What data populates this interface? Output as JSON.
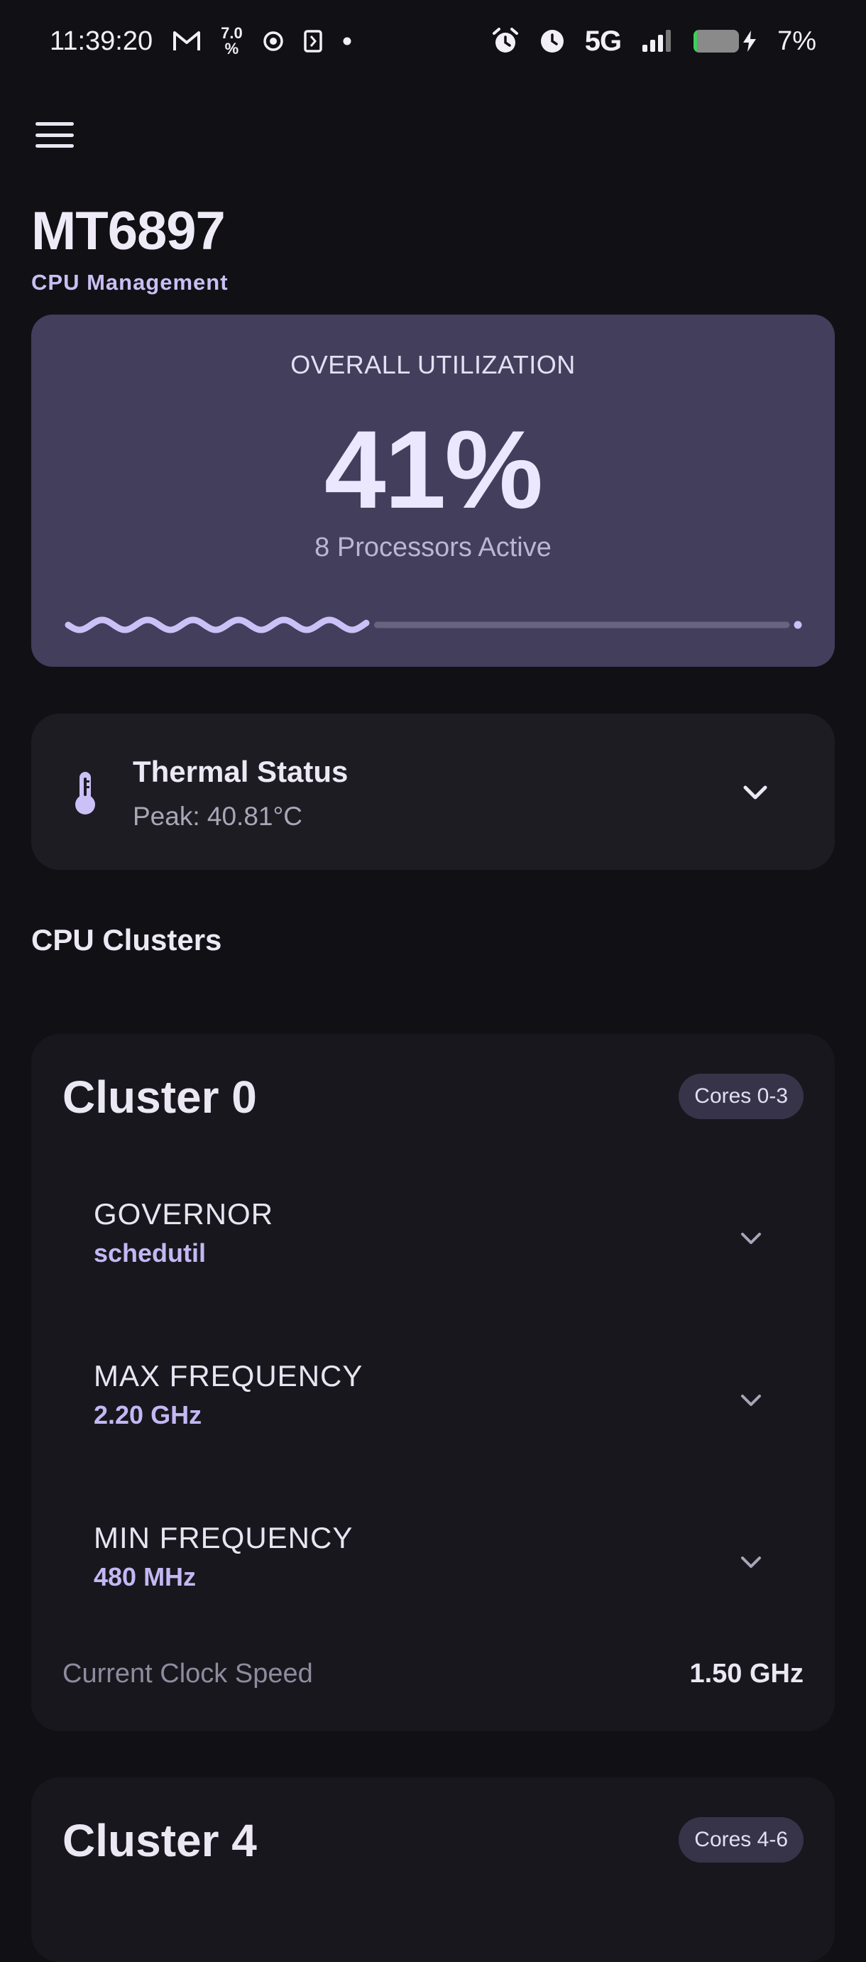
{
  "status_bar": {
    "time": "11:39:20",
    "indicator_top": "7.0",
    "indicator_bottom": "%",
    "network": "5G",
    "battery": "7%",
    "battery_level": 0.07,
    "icons": [
      "gmail-icon",
      "data-speed-icon",
      "record-icon",
      "sim-icon",
      "dot-icon",
      "alarm-icon",
      "clock-icon",
      "signal-icon",
      "battery-icon",
      "charging-icon"
    ]
  },
  "header": {
    "title": "MT6897",
    "subtitle": "CPU Management"
  },
  "utilization": {
    "label": "OVERALL UTILIZATION",
    "value": "41%",
    "fraction": 0.41,
    "subtitle": "8 Processors Active"
  },
  "thermal": {
    "title": "Thermal Status",
    "peak": "Peak: 40.81°C"
  },
  "section": {
    "title": "CPU Clusters"
  },
  "clusters": [
    {
      "name": "Cluster 0",
      "cores": "Cores 0-3",
      "settings": [
        {
          "label": "GOVERNOR",
          "value": "schedutil"
        },
        {
          "label": "MAX FREQUENCY",
          "value": "2.20 GHz"
        },
        {
          "label": "MIN FREQUENCY",
          "value": "480 MHz"
        }
      ],
      "clock_label": "Current Clock Speed",
      "clock_value": "1.50 GHz"
    },
    {
      "name": "Cluster 4",
      "cores": "Cores 4-6"
    }
  ],
  "colors": {
    "background": "#111015",
    "accent": "#c3b8f4",
    "card_utilization": "#423e5c",
    "card": "#18171d"
  }
}
